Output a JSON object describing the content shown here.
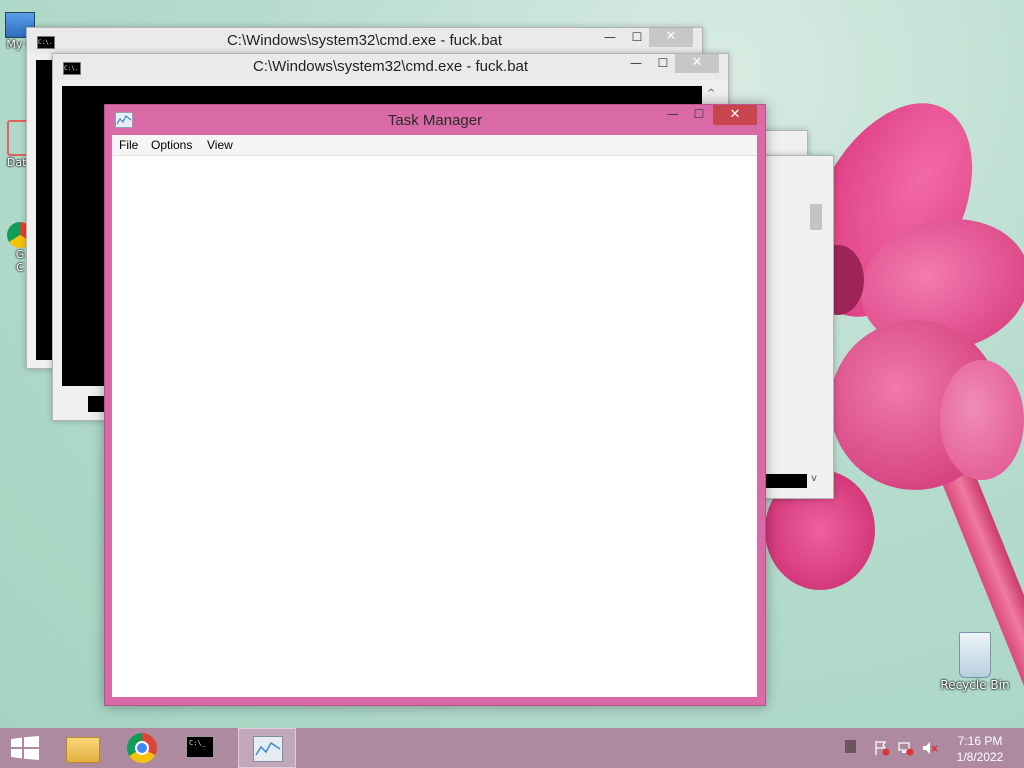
{
  "desktop": {
    "icons": [
      {
        "label": "My C"
      },
      {
        "label": "Data"
      },
      {
        "label": "G"
      },
      {
        "label": "C"
      },
      {
        "label": "Recycle Bin"
      }
    ]
  },
  "cmd_windows": [
    {
      "title": "C:\\Windows\\system32\\cmd.exe - fuck.bat",
      "icon_text": "C:\\."
    },
    {
      "title": "C:\\Windows\\system32\\cmd.exe - fuck.bat",
      "icon_text": "C:\\."
    }
  ],
  "task_manager": {
    "title": "Task Manager",
    "menu": [
      "File",
      "Options",
      "View"
    ],
    "min_glyph": "—",
    "max_glyph": "☐",
    "close_glyph": "✕"
  },
  "window_controls": {
    "min": "—",
    "max": "☐",
    "close": "✕"
  },
  "scroll": {
    "up": "^",
    "down": "v"
  },
  "taskbar": {
    "cmd_icon_text": "C:\\_",
    "time": "7:16 PM",
    "date": "1/8/2022"
  },
  "colors": {
    "accent": "#d96aa6",
    "taskbar": "#ad8aa0",
    "close_red": "#c7454d"
  }
}
